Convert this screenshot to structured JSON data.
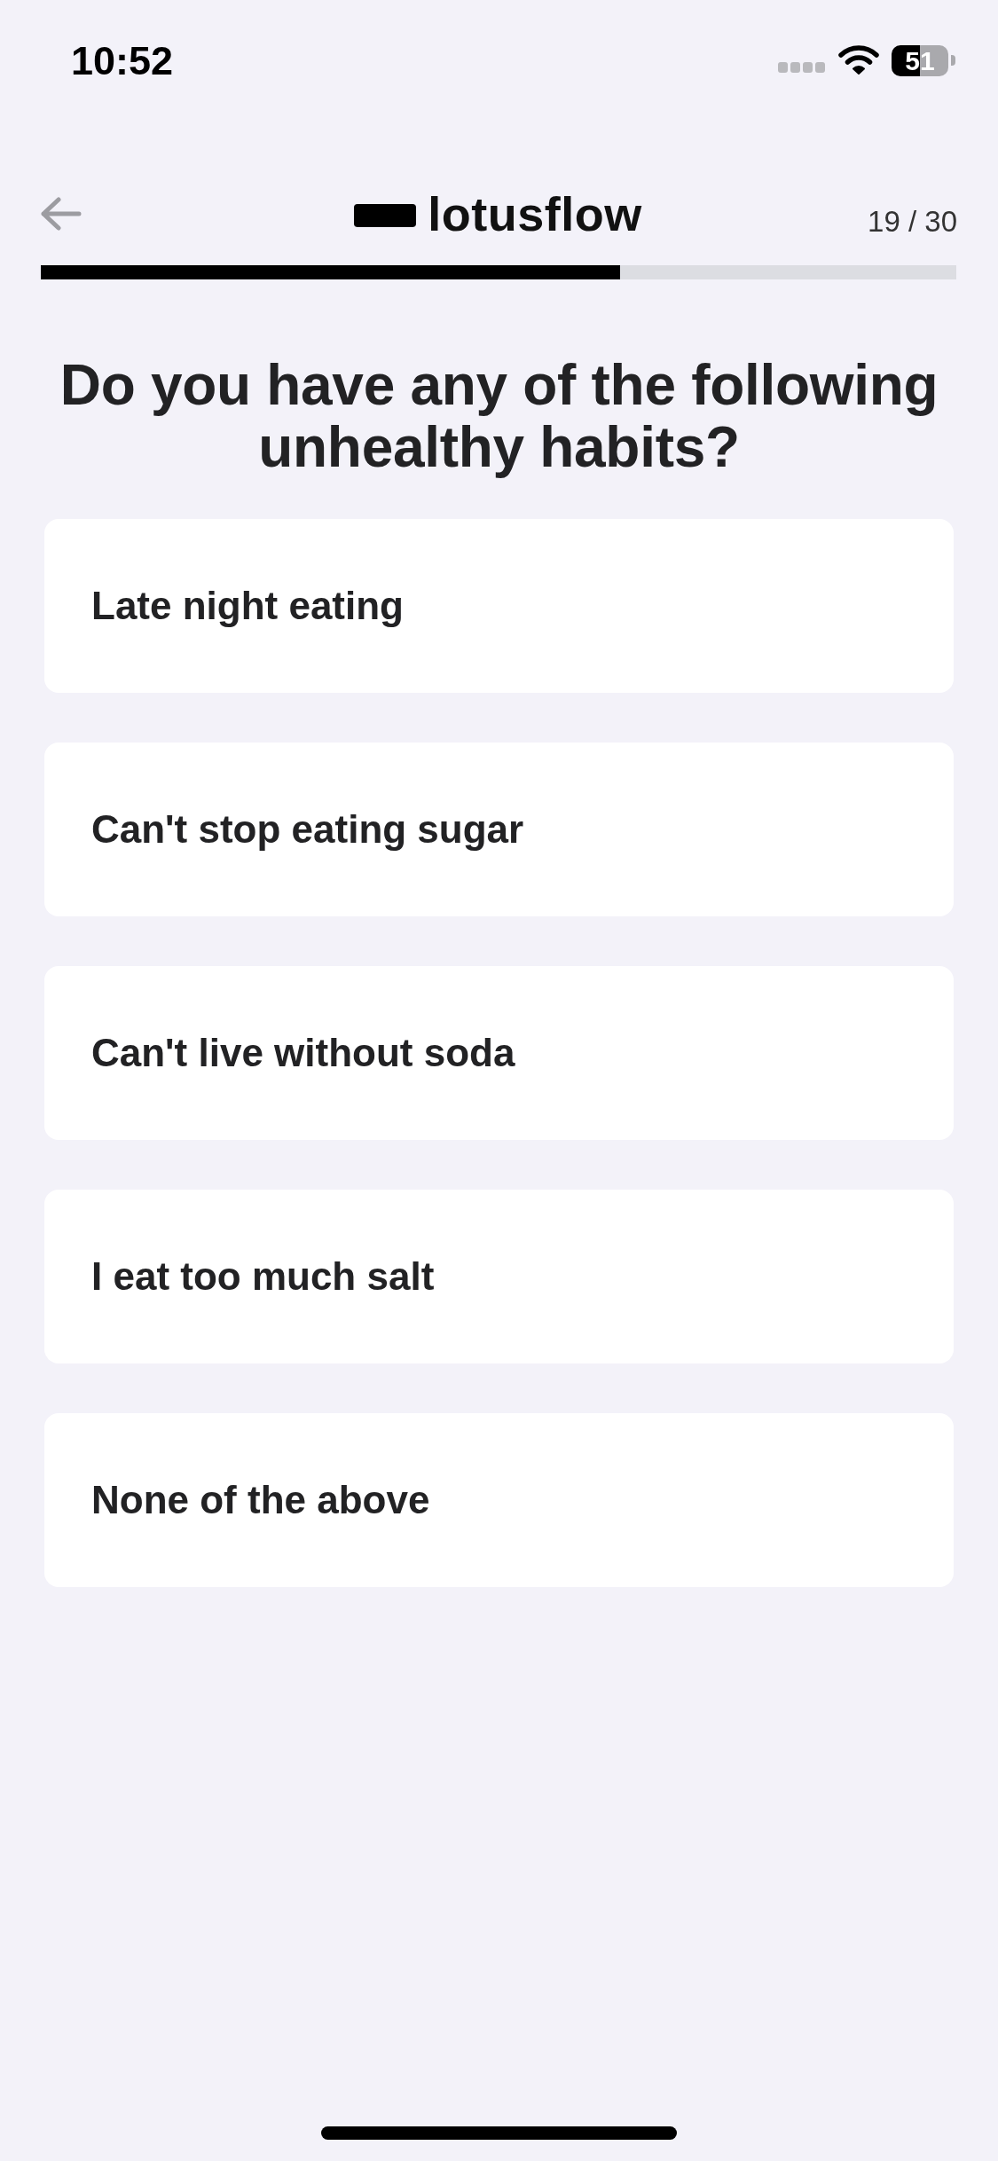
{
  "status_bar": {
    "time": "10:52",
    "battery": "51"
  },
  "header": {
    "logo_text": "lotusflow",
    "step": "19 / 30",
    "progress": {
      "level": 0.633
    }
  },
  "question": "Do you have any of the following unhealthy habits?",
  "options": [
    {
      "label": "Late night eating",
      "selected": false
    },
    {
      "label": "Can't stop eating sugar",
      "selected": false
    },
    {
      "label": "Can't live without soda",
      "selected": false
    },
    {
      "label": "I eat too much salt",
      "selected": false
    },
    {
      "label": "None of the above",
      "selected": false
    }
  ]
}
